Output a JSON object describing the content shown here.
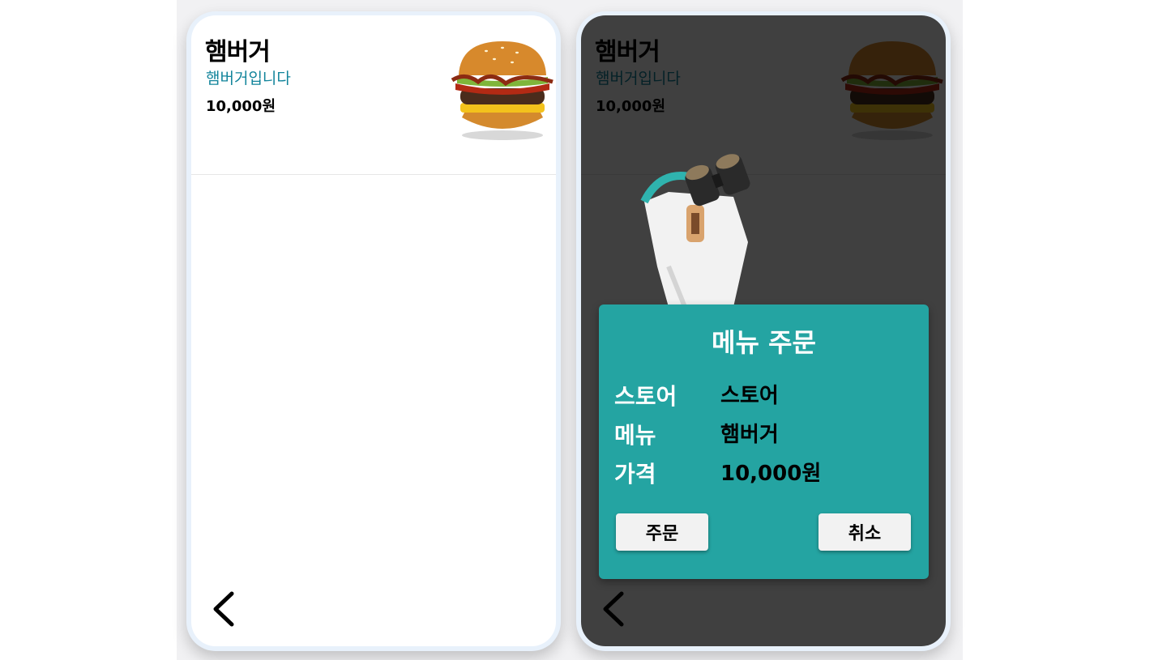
{
  "item": {
    "name": "햄버거",
    "description": "햄버거입니다",
    "price": "10,000원",
    "image_icon": "hamburger-image"
  },
  "nav": {
    "back_icon": "chevron-left-icon"
  },
  "modal": {
    "title": "메뉴 주문",
    "rows": [
      {
        "label": "스토어",
        "value": "스토어"
      },
      {
        "label": "메뉴",
        "value": "햄버거"
      },
      {
        "label": "가격",
        "value": "10,000원"
      }
    ],
    "order_label": "주문",
    "cancel_label": "취소"
  },
  "colors": {
    "accent": "#24a4a2",
    "description_text": "#12849b",
    "overlay": "rgba(0,0,0,0.75)"
  }
}
